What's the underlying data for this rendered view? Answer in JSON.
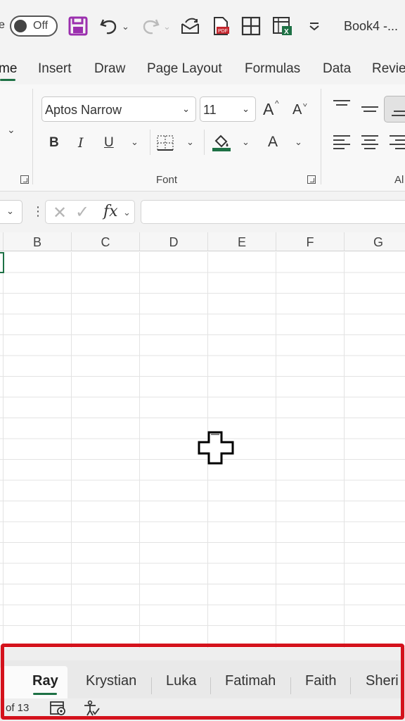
{
  "titlebar": {
    "autosave_label": "e",
    "autosave_state": "Off",
    "book_title": "Book4  -..."
  },
  "ribbon_tabs": [
    "me",
    "Insert",
    "Draw",
    "Page Layout",
    "Formulas",
    "Data",
    "Revie"
  ],
  "active_tab": "me",
  "ribbon": {
    "font_name": "Aptos Narrow",
    "font_size": "11",
    "grow_font": "A",
    "shrink_font": "A",
    "bold": "B",
    "italic": "I",
    "underline": "U",
    "font_color": "A",
    "group_font": "Font",
    "group_alignment": "Al"
  },
  "formula_bar": {
    "fx_label": "fx",
    "cancel_glyph": "✕",
    "enter_glyph": "✓",
    "formula": ""
  },
  "columns": [
    "B",
    "C",
    "D",
    "E",
    "F",
    "G"
  ],
  "sheets": [
    "Ray",
    "Krystian",
    "Luka",
    "Fatimah",
    "Faith",
    "Sheri"
  ],
  "active_sheet": "Ray",
  "status": {
    "sheet_count_text": "of 13"
  },
  "colors": {
    "accent_green": "#1e7145",
    "highlight_red": "#d4121c",
    "save_purple": "#9b2fae",
    "pdf_red": "#c4262e"
  },
  "icons": [
    "save-icon",
    "undo-icon",
    "redo-icon",
    "email-icon",
    "pdf-icon",
    "borders-icon",
    "excel-table-icon",
    "customize-icon",
    "fill-color-icon",
    "accessibility-icon",
    "cell-mode-icon"
  ]
}
